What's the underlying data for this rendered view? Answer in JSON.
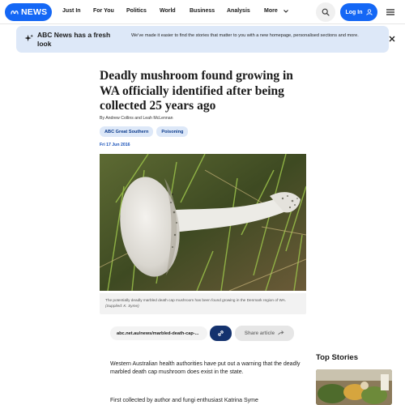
{
  "header": {
    "logo_text": "NEWS",
    "nav": [
      {
        "label": "Just In"
      },
      {
        "label": "For You"
      },
      {
        "label": "Politics"
      },
      {
        "label": "World"
      },
      {
        "label": "Business"
      },
      {
        "label": "Analysis"
      },
      {
        "label": "More"
      }
    ],
    "login_label": "Log In",
    "icons": [
      "abc-logo-icon",
      "search-icon",
      "user-icon",
      "menu-icon",
      "chevron-down-icon"
    ]
  },
  "banner": {
    "title": "ABC News has a fresh look",
    "message": "We've made it easier to find the stories that matter to you with a new homepage, personalised sections and more.",
    "icons": [
      "sparkle-icon",
      "close-icon"
    ]
  },
  "article": {
    "headline": "Deadly mushroom found growing in WA officially identified after being collected 25 years ago",
    "byline": "By Andrew Collins and Leah McLennan",
    "tags": [
      {
        "label": "ABC Great Southern"
      },
      {
        "label": "Poisoning"
      }
    ],
    "date": "Fri 17 Jun 2016",
    "caption": "The potentially deadly marbled death cap mushroom has been found growing in the Denmark region of WA.",
    "caption_credit": "(Supplied: K. Syme)",
    "share_url": "abc.net.au/news/marbled-death-cap-...",
    "share_label": "Share article",
    "paragraphs": [
      "Western Australian health authorities have put out a warning that the deadly marbled death cap mushroom does exist in the state.",
      "First collected by author and fungi enthusiast Katrina Syme"
    ]
  },
  "sidebar": {
    "top_stories_label": "Top Stories"
  },
  "colors": {
    "brand_blue": "#1467f5",
    "banner_bg": "#dde8f8",
    "copy_button": "#14326e"
  }
}
